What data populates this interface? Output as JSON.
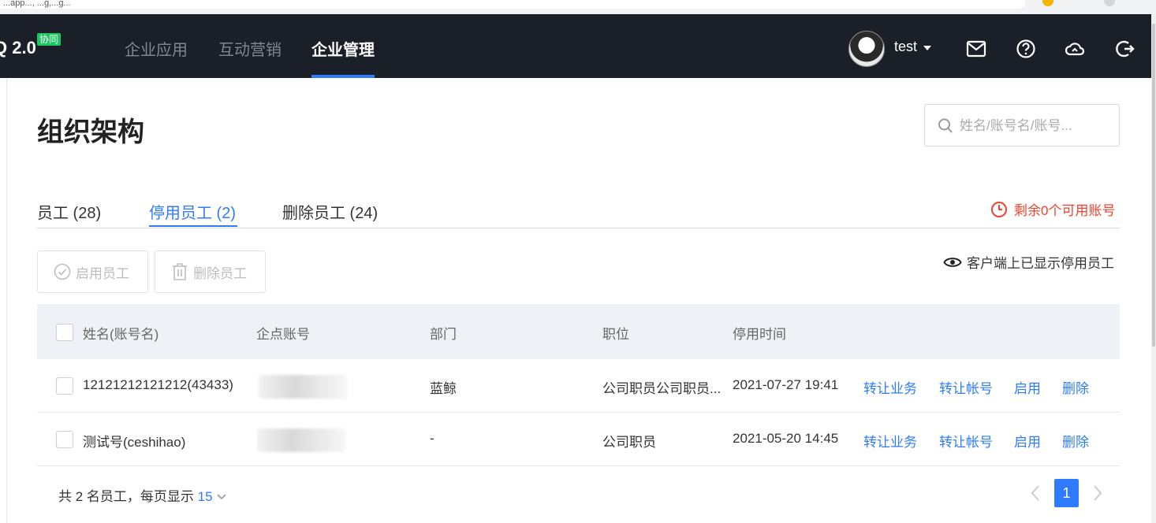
{
  "browser": {
    "url_text": "...app..., ...g,...g..."
  },
  "topnav": {
    "logo_text": "Q 2.0",
    "logo_badge": "协同",
    "items": [
      {
        "label": "企业应用",
        "active": false
      },
      {
        "label": "互动营销",
        "active": false
      },
      {
        "label": "企业管理",
        "active": true
      }
    ],
    "user": "test",
    "icons": [
      "mail-icon",
      "help-icon",
      "cloud-icon",
      "logout-icon"
    ]
  },
  "page": {
    "title": "组织架构",
    "search_placeholder": "姓名/账号名/账号..."
  },
  "tabs": [
    {
      "label": "员工 (28)",
      "active": false
    },
    {
      "label": "停用员工 (2)",
      "active": true
    },
    {
      "label": "删除员工 (24)",
      "active": false
    }
  ],
  "remaining_accounts": "剩余0个可用账号",
  "actions": {
    "enable_label": "启用员工",
    "delete_label": "删除员工",
    "client_display": "客户端上已显示停用员工"
  },
  "table": {
    "headers": {
      "name": "姓名(账号名)",
      "account": "企点账号",
      "department": "部门",
      "position": "职位",
      "disabled_time": "停用时间"
    },
    "rows": [
      {
        "name": "12121212121212(43433)",
        "account_masked": true,
        "department": "蓝鲸",
        "position": "公司职员公司职员...",
        "disabled_time": "2021-07-27 19:41",
        "ops": [
          "转让业务",
          "转让帐号",
          "启用",
          "删除"
        ]
      },
      {
        "name": "测试号(ceshihao)",
        "account_masked": true,
        "department": "-",
        "position": "公司职员",
        "disabled_time": "2021-05-20 14:45",
        "ops": [
          "转让业务",
          "转让帐号",
          "启用",
          "删除"
        ]
      }
    ]
  },
  "footer": {
    "summary_prefix": "共 2 名员工，每页显示",
    "page_size": "15",
    "current_page": "1"
  },
  "colors": {
    "nav_bg": "#1b2028",
    "accent": "#2f7bff",
    "warning": "#f2412c",
    "badge": "#19c860"
  }
}
